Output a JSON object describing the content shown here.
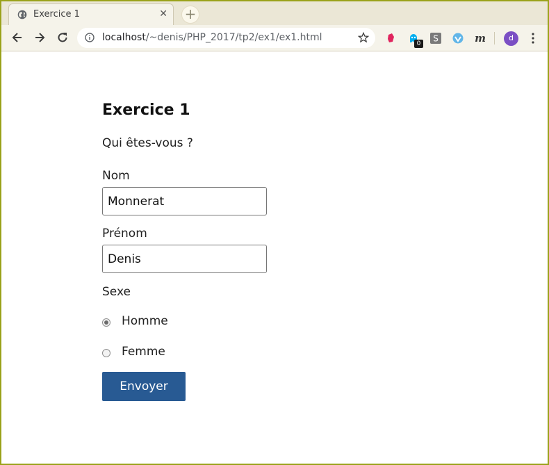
{
  "browser": {
    "tab": {
      "title": "Exercice 1"
    },
    "address": {
      "host": "localhost",
      "path": "/~denis/PHP_2017/tp2/ex1/ex1.html"
    },
    "extensions": [
      "gift-icon",
      "ghostery-icon",
      "s-extension-icon",
      "vpn-shield-icon",
      "m-extension-icon"
    ],
    "badge_count": "0",
    "profile_initial": "d"
  },
  "page": {
    "title": "Exercice 1",
    "subtitle": "Qui êtes-vous ?",
    "nom": {
      "label": "Nom",
      "value": "Monnerat"
    },
    "prenom": {
      "label": "Prénom",
      "value": "Denis"
    },
    "sexe": {
      "label": "Sexe",
      "options": [
        {
          "label": "Homme",
          "checked": true
        },
        {
          "label": "Femme",
          "checked": false
        }
      ]
    },
    "submit_label": "Envoyer"
  },
  "colors": {
    "submit_bg": "#285a93",
    "frame": "#9aa21a",
    "chrome_bg": "#ebe7d6"
  }
}
